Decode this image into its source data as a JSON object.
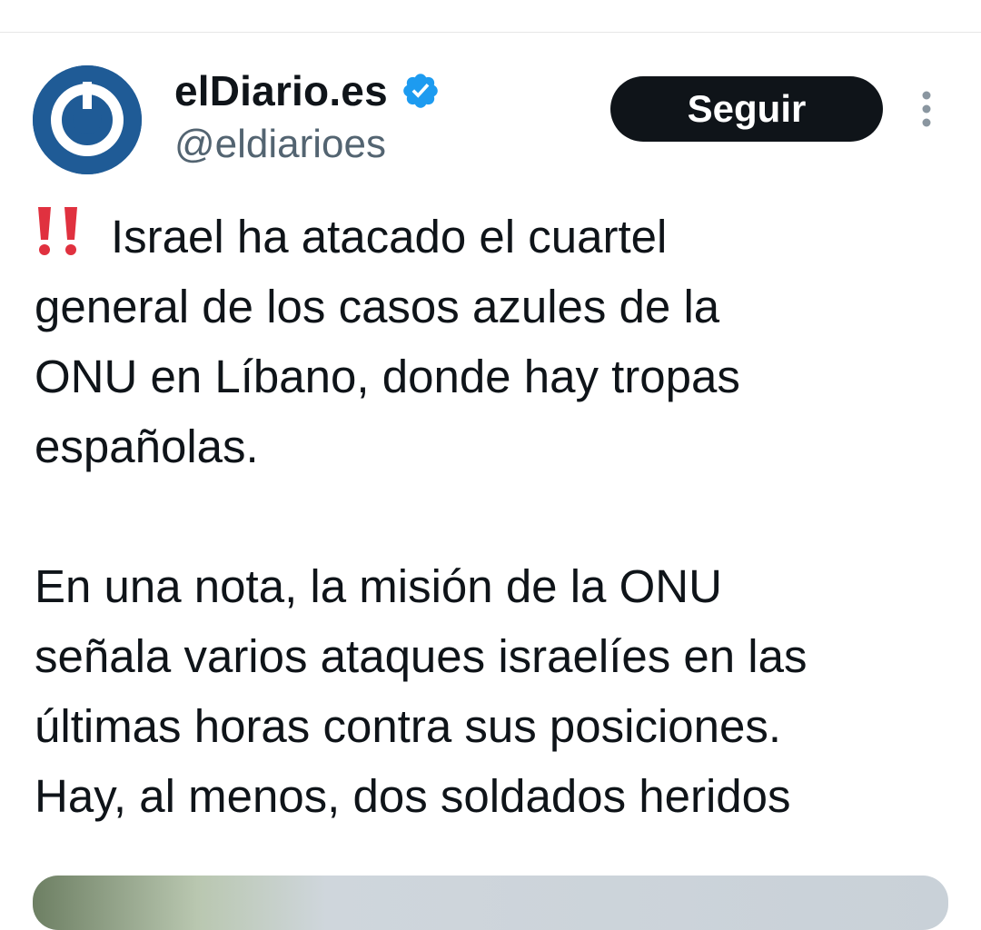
{
  "tweet": {
    "author": {
      "display_name": "elDiario.es",
      "handle": "@eldiarioes",
      "verified": true,
      "avatar_icon": "eldiario-logo-icon",
      "avatar_color": "#1f5b96"
    },
    "follow_label": "Seguir",
    "more_icon": "more-vertical-icon",
    "body": {
      "alert_icon": "double-exclamation-icon",
      "paragraph1_lines": [
        "Israel ha atacado el cuartel",
        "general de los casos azules de la",
        "ONU en Líbano, donde hay tropas",
        "españolas."
      ],
      "paragraph2_lines": [
        "En una nota, la misión de la ONU",
        "señala varios ataques israelíes en las",
        "últimas horas contra sus posiciones.",
        "Hay, al menos, dos soldados heridos"
      ]
    }
  },
  "colors": {
    "follow_button_bg": "#0f1419",
    "verified_badge": "#1d9bf0",
    "alert_red": "#e0313f",
    "handle_gray": "#536471"
  }
}
